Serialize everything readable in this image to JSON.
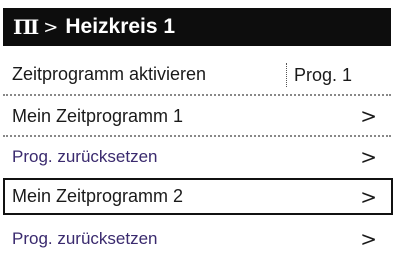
{
  "header": {
    "icon": "heating-circuit-icon",
    "icon_glyph": "ΠΙ",
    "separator": ">",
    "title": "Heizkreis 1"
  },
  "menu": {
    "items": [
      {
        "label": "Zeitprogramm aktivieren",
        "value": "Prog. 1"
      },
      {
        "label": "Mein Zeitprogramm  1",
        "chevron": ">"
      },
      {
        "label": "Prog. zurücksetzen",
        "chevron": ">"
      },
      {
        "label": "Mein Zeitprogramm  2",
        "chevron": ">",
        "selected": true
      },
      {
        "label": "Prog. zurücksetzen",
        "chevron": ">"
      }
    ]
  },
  "colors": {
    "header_bg": "#0d0d0d",
    "header_text": "#ffffff",
    "text": "#1a1a1a",
    "subtext": "#3a2a6e",
    "selection_border": "#111111"
  }
}
